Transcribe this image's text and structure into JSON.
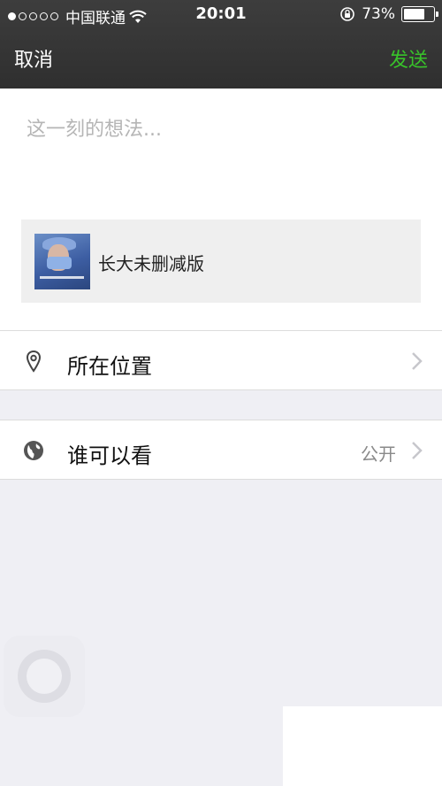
{
  "status_bar": {
    "carrier": "中国联通",
    "time": "20:01",
    "battery_percent": "73%",
    "battery_level": 0.73,
    "signal_strength": 1,
    "icons": [
      "wifi-icon",
      "orientation-lock-icon",
      "battery-icon"
    ]
  },
  "nav": {
    "cancel_label": "取消",
    "send_label": "发送",
    "send_color": "#38c32a"
  },
  "compose": {
    "placeholder": "这一刻的想法..."
  },
  "shared_item": {
    "title": "长大未删减版"
  },
  "rows": {
    "location": {
      "label": "所在位置",
      "icon": "location-pin-icon"
    },
    "visibility": {
      "label": "谁可以看",
      "value": "公开",
      "icon": "globe-icon"
    }
  }
}
